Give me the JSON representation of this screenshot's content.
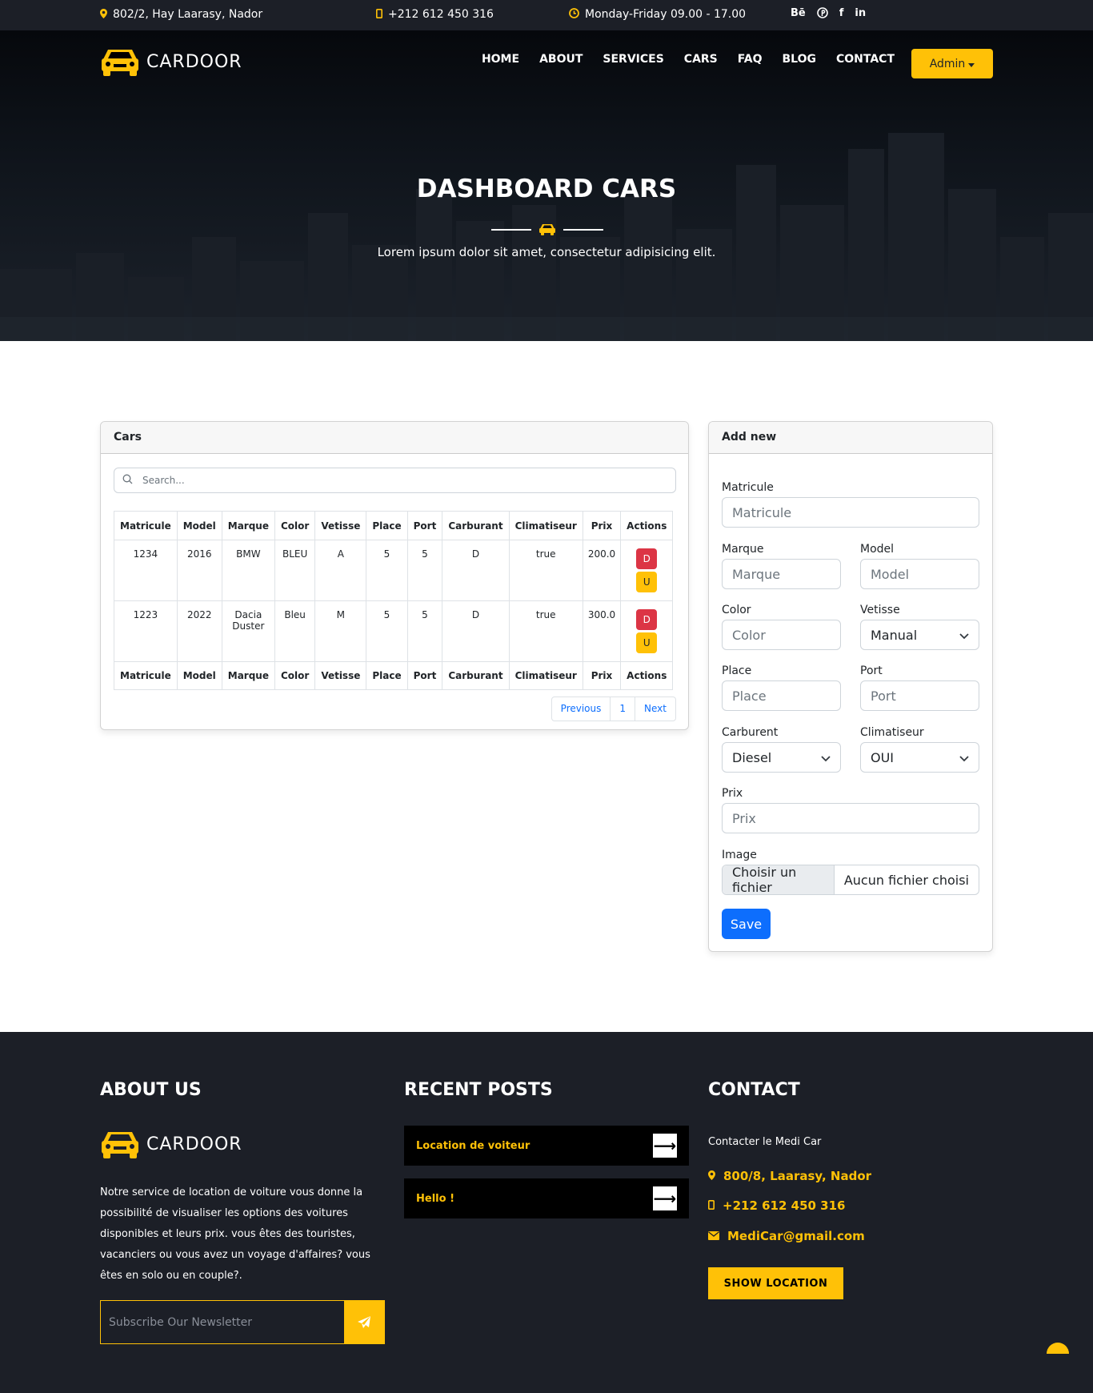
{
  "topbar": {
    "address": "802/2, Hay Laarasy, Nador",
    "phone": "+212 612 450 316",
    "hours": "Monday-Friday 09.00 - 17.00",
    "socials": [
      "Bē",
      "P",
      "f",
      "in"
    ]
  },
  "brand": {
    "name": "CARDOOR",
    "accent_color": "#ffc107"
  },
  "nav": {
    "items": [
      "HOME",
      "ABOUT",
      "SERVICES",
      "CARS",
      "FAQ",
      "BLOG",
      "CONTACT"
    ],
    "admin_label": "Admin"
  },
  "hero": {
    "title": "DASHBOARD CARS",
    "subtitle": "Lorem ipsum dolor sit amet, consectetur adipisicing elit."
  },
  "cars_card": {
    "title": "Cars",
    "search_placeholder": "Search...",
    "columns": [
      "Matricule",
      "Model",
      "Marque",
      "Color",
      "Vetisse",
      "Place",
      "Port",
      "Carburant",
      "Climatiseur",
      "Prix",
      "Actions"
    ],
    "rows": [
      [
        "1234",
        "2016",
        "BMW",
        "BLEU",
        "A",
        "5",
        "5",
        "D",
        "true",
        "200.0"
      ],
      [
        "1223",
        "2022",
        "Dacia Duster",
        "Bleu",
        "M",
        "5",
        "5",
        "D",
        "true",
        "300.0"
      ]
    ],
    "delete_label": "D",
    "update_label": "U",
    "pagination": {
      "previous": "Previous",
      "page": "1",
      "next": "Next"
    }
  },
  "add_form": {
    "title": "Add new",
    "matricule": {
      "label": "Matricule",
      "placeholder": "Matricule"
    },
    "marque": {
      "label": "Marque",
      "placeholder": "Marque"
    },
    "model": {
      "label": "Model",
      "placeholder": "Model"
    },
    "color": {
      "label": "Color",
      "placeholder": "Color"
    },
    "vetisse": {
      "label": "Vetisse",
      "value": "Manual"
    },
    "place": {
      "label": "Place",
      "placeholder": "Place"
    },
    "port": {
      "label": "Port",
      "placeholder": "Port"
    },
    "carburent": {
      "label": "Carburent",
      "value": "Diesel"
    },
    "climatiseur": {
      "label": "Climatiseur",
      "value": "OUI"
    },
    "prix": {
      "label": "Prix",
      "placeholder": "Prix"
    },
    "image": {
      "label": "Image",
      "button": "Choisir un fichier",
      "status": "Aucun fichier choisi"
    },
    "save_label": "Save"
  },
  "footer": {
    "about_title": "ABOUT US",
    "about_text": "Notre service de location de voiture vous donne la possibilité de visualiser les options des voitures disponibles et leurs prix. vous êtes des touristes, vacanciers ou vous avez un voyage d'affaires? vous êtes en solo ou en couple?.",
    "newsletter_placeholder": "Subscribe Our Newsletter",
    "posts_title": "RECENT POSTS",
    "posts": [
      "Location de voiteur",
      "Hello !"
    ],
    "contact_title": "CONTACT",
    "contact_intro": "Contacter le Medi Car",
    "contact_address": "800/8, Laarasy, Nador",
    "contact_phone": "+212 612 450 316",
    "contact_email": "MediCar@gmail.com",
    "show_location": "SHOW LOCATION"
  }
}
